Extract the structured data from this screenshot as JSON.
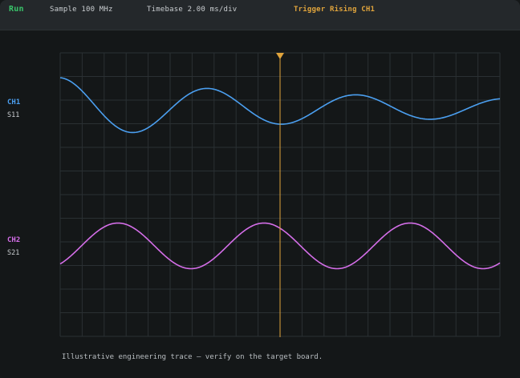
{
  "status_bar": {
    "run_state": "Run",
    "sample_rate": "Sample 100 MHz",
    "timebase": "Timebase 2.00 ms/div",
    "trigger": "Trigger Rising CH1"
  },
  "channels": [
    {
      "name": "CH1",
      "parameter": "S11",
      "color": "#4b9ff0"
    },
    {
      "name": "CH2",
      "parameter": "S21",
      "color": "#d46ee8"
    }
  ],
  "colors": {
    "background": "#141718",
    "grid": "#2a3033",
    "trigger": "#e0a43c",
    "run": "#39c46a"
  },
  "trigger_marker_icon": "triangle-down-icon",
  "footnote": "Illustrative engineering trace — verify on the target board."
}
